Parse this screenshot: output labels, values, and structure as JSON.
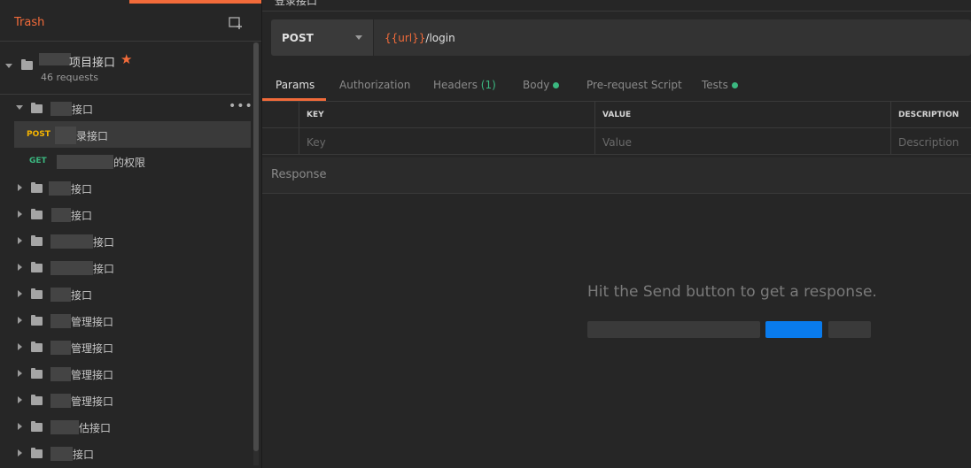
{
  "sidebar": {
    "trash_label": "Trash",
    "collection": {
      "title": "项目接口",
      "count": "46 requests"
    },
    "rows": [
      {
        "type": "folder",
        "label": "接口",
        "expanded": true
      },
      {
        "type": "request",
        "method": "POST",
        "label": "录接口",
        "selected": true
      },
      {
        "type": "request",
        "method": "GET",
        "label": "的权限"
      },
      {
        "type": "folder",
        "label": "接口"
      },
      {
        "type": "folder",
        "label": "接口"
      },
      {
        "type": "folder",
        "label": "接口"
      },
      {
        "type": "folder",
        "label": "接口"
      },
      {
        "type": "folder",
        "label": "接口"
      },
      {
        "type": "folder",
        "label": "管理接口"
      },
      {
        "type": "folder",
        "label": "管理接口"
      },
      {
        "type": "folder",
        "label": "管理接口"
      },
      {
        "type": "folder",
        "label": "管理接口"
      },
      {
        "type": "folder",
        "label": "估接口"
      },
      {
        "type": "folder",
        "label": "接口"
      }
    ],
    "more_label": "•••"
  },
  "main": {
    "request_title": "登录接口",
    "method": "POST",
    "url_var": "{{url}}",
    "url_path": "/login",
    "tabs": [
      {
        "label": "Params",
        "active": true
      },
      {
        "label": "Authorization"
      },
      {
        "label": "Headers",
        "count": "(1)"
      },
      {
        "label": "Body",
        "dot": true
      },
      {
        "label": "Pre-request Script"
      },
      {
        "label": "Tests",
        "dot": true
      }
    ],
    "table": {
      "headers": [
        "KEY",
        "VALUE",
        "DESCRIPTION"
      ],
      "placeholders": [
        "Key",
        "Value",
        "Description"
      ]
    },
    "response_label": "Response",
    "empty_message": "Hit the Send button to get a response."
  },
  "colors": {
    "accent": "#f26b3a",
    "post": "#f5b400",
    "get": "#3bb880",
    "send_button": "#097bed"
  }
}
